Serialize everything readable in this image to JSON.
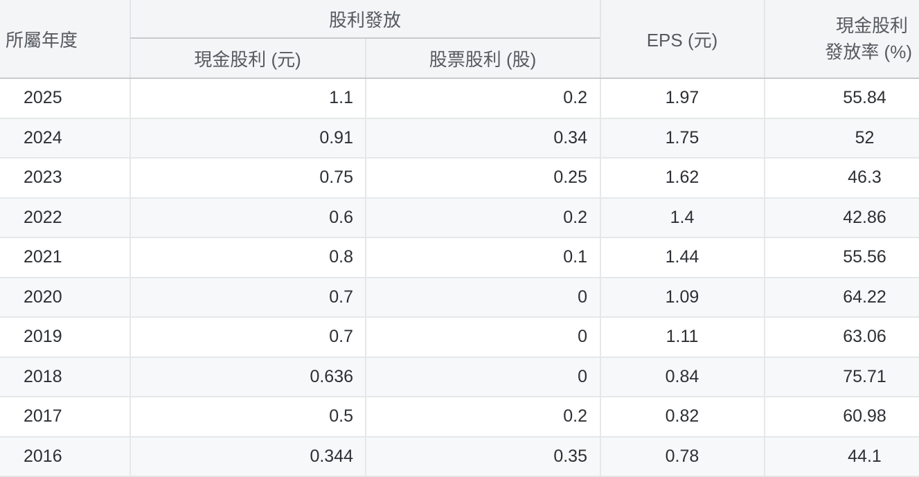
{
  "table": {
    "headers": {
      "year": "所屬年度",
      "dividend_group": "股利發放",
      "cash_dividend": "現金股利 (元)",
      "stock_dividend": "股票股利 (股)",
      "eps": "EPS (元)",
      "payout_ratio_line1": "現金股利",
      "payout_ratio_line2": "發放率 (%)"
    },
    "rows": [
      {
        "year": "2025",
        "cash": "1.1",
        "stock": "0.2",
        "eps": "1.97",
        "ratio": "55.84"
      },
      {
        "year": "2024",
        "cash": "0.91",
        "stock": "0.34",
        "eps": "1.75",
        "ratio": "52"
      },
      {
        "year": "2023",
        "cash": "0.75",
        "stock": "0.25",
        "eps": "1.62",
        "ratio": "46.3"
      },
      {
        "year": "2022",
        "cash": "0.6",
        "stock": "0.2",
        "eps": "1.4",
        "ratio": "42.86"
      },
      {
        "year": "2021",
        "cash": "0.8",
        "stock": "0.1",
        "eps": "1.44",
        "ratio": "55.56"
      },
      {
        "year": "2020",
        "cash": "0.7",
        "stock": "0",
        "eps": "1.09",
        "ratio": "64.22"
      },
      {
        "year": "2019",
        "cash": "0.7",
        "stock": "0",
        "eps": "1.11",
        "ratio": "63.06"
      },
      {
        "year": "2018",
        "cash": "0.636",
        "stock": "0",
        "eps": "0.84",
        "ratio": "75.71"
      },
      {
        "year": "2017",
        "cash": "0.5",
        "stock": "0.2",
        "eps": "0.82",
        "ratio": "60.98"
      },
      {
        "year": "2016",
        "cash": "0.344",
        "stock": "0.35",
        "eps": "0.78",
        "ratio": "44.1"
      }
    ]
  }
}
